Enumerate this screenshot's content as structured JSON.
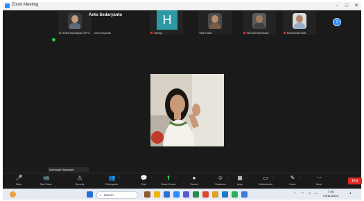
{
  "window": {
    "title": "Zoom Meeting"
  },
  "gallery": {
    "featured_name": "Anto Sedaryanto",
    "tiles": [
      {
        "name": "Dr. Imelia Nurhidayah, M.Pd",
        "muted": false,
        "bg": "#3a3a3a",
        "skin": "#c79b7a",
        "shirt": "#5d6b7a"
      },
      {
        "name": "Dewi Setyowati",
        "muted": false,
        "bg": "#333333",
        "skin": "#b58a6a",
        "shirt": "#8a7a6a"
      },
      {
        "name": "Hartoyo",
        "muted": true,
        "bg": "#2c9aa4",
        "skin": "#2c9aa4",
        "shirt": "#2c9aa4"
      },
      {
        "name": "Yanti Yunita",
        "muted": false,
        "bg": "#4a4a4a",
        "skin": "#b98c6b",
        "shirt": "#7a5a4a"
      },
      {
        "name": "Novi Siti Rahmawati",
        "muted": true,
        "bg": "#5a5a5a",
        "skin": "#a07a5a",
        "shirt": "#404040"
      },
      {
        "name": "Muhammad Rizal",
        "muted": true,
        "bg": "#dcdcdc",
        "skin": "#b0866a",
        "shirt": "#9ab0c8"
      }
    ],
    "h_avatar": "H",
    "more_badge": "3"
  },
  "main_speaker": {
    "name": "Nurhayati Ratnasari"
  },
  "toolbar": {
    "items": [
      {
        "label": "Mute",
        "icon": "🎤"
      },
      {
        "label": "Start Video",
        "icon": "📹"
      },
      {
        "label": "Security",
        "icon": "⚠"
      },
      {
        "label": "Participants",
        "icon": "👥"
      },
      {
        "label": "Chat",
        "icon": "💬"
      },
      {
        "label": "Share Screen",
        "icon": "⬆"
      },
      {
        "label": "Record",
        "icon": "●"
      },
      {
        "label": "Reactions",
        "icon": "☺"
      },
      {
        "label": "Apps",
        "icon": "▦"
      },
      {
        "label": "Whiteboards",
        "icon": "▭"
      },
      {
        "label": "Notes",
        "icon": "✎"
      },
      {
        "label": "More",
        "icon": "⋯"
      }
    ],
    "end": "End"
  },
  "taskbar": {
    "search": "Search",
    "time": "7:06",
    "date": "24/11/2023"
  },
  "colors": {
    "accent": "#2d8cff",
    "end": "#e02828",
    "share": "#23d160"
  }
}
